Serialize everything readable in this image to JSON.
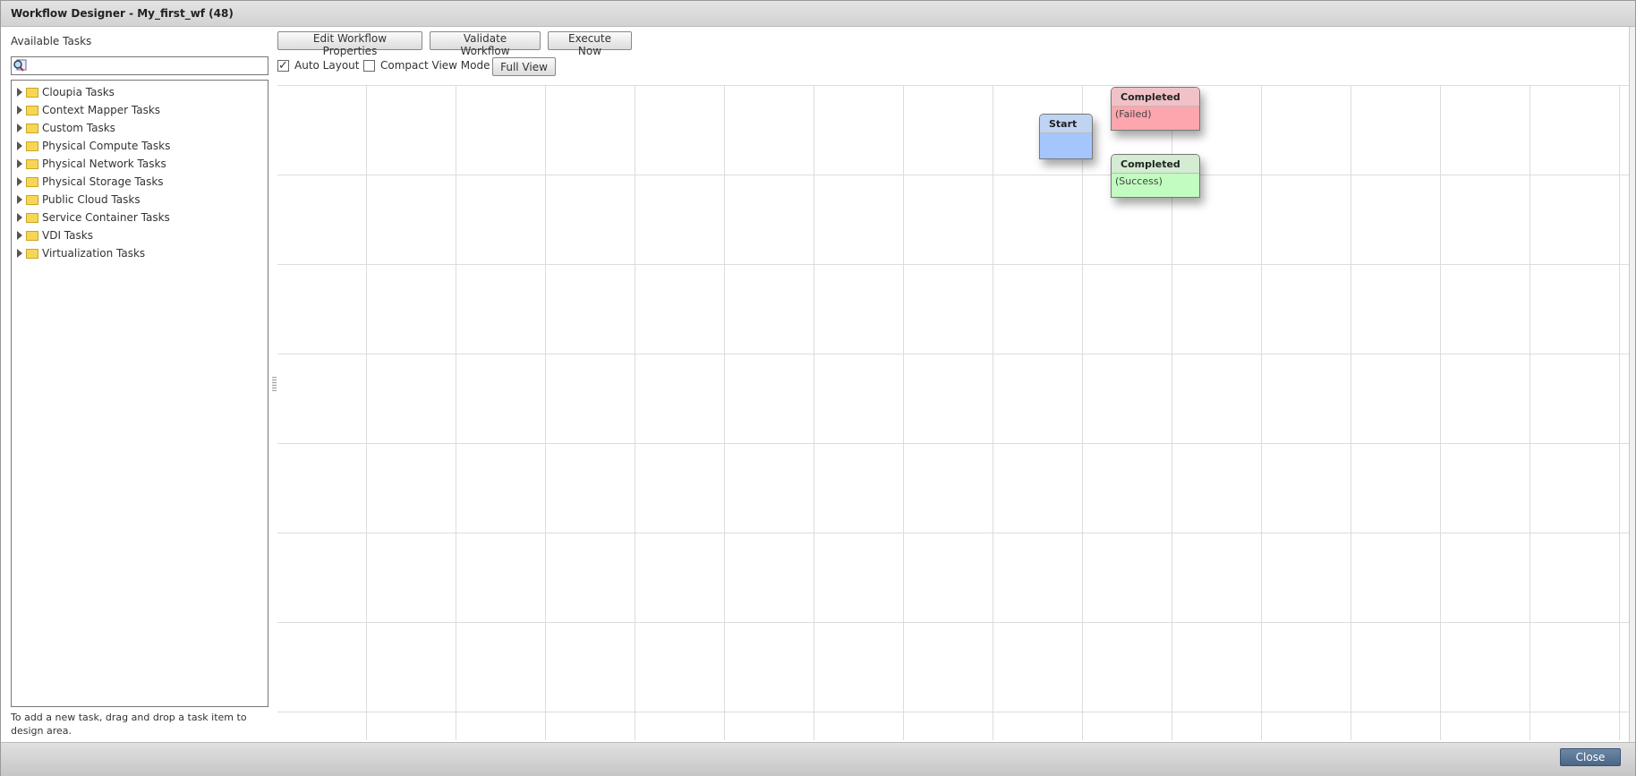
{
  "window": {
    "title": "Workflow Designer - My_first_wf (48)"
  },
  "left_panel": {
    "label": "Available Tasks",
    "search": {
      "value": "",
      "placeholder": ""
    },
    "tree": [
      {
        "label": "Cloupia Tasks"
      },
      {
        "label": "Context Mapper Tasks"
      },
      {
        "label": "Custom Tasks"
      },
      {
        "label": "Physical Compute Tasks"
      },
      {
        "label": "Physical Network Tasks"
      },
      {
        "label": "Physical Storage Tasks"
      },
      {
        "label": "Public Cloud Tasks"
      },
      {
        "label": "Service Container Tasks"
      },
      {
        "label": "VDI Tasks"
      },
      {
        "label": "Virtualization Tasks"
      }
    ],
    "help": "To add a new task, drag and drop a task item to design area."
  },
  "toolbar": {
    "edit_properties": "Edit Workflow Properties",
    "validate": "Validate Workflow",
    "execute": "Execute Now",
    "auto_layout": {
      "label": "Auto Layout",
      "checked": true
    },
    "compact_view": {
      "label": "Compact View Mode",
      "checked": false
    },
    "full_view": "Full View"
  },
  "nodes": {
    "start": {
      "title": "Start",
      "subtitle": "",
      "color": "#a4c6fd"
    },
    "failed": {
      "title": "Completed",
      "subtitle": "(Failed)",
      "color": "#fda6ae"
    },
    "success": {
      "title": "Completed",
      "subtitle": "(Success)",
      "color": "#c2fcc0"
    }
  },
  "footer": {
    "close": "Close"
  }
}
